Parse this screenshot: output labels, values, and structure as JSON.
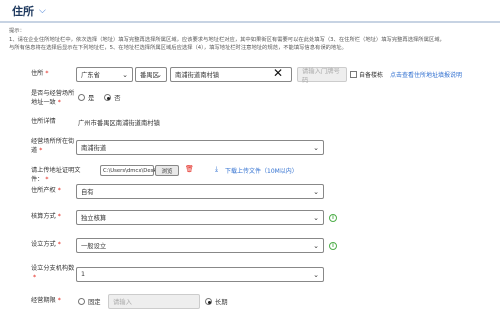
{
  "header": {
    "title": "住所",
    "collapse_icon": "chevron-down-icon"
  },
  "notes": [
    "提示：",
    "1、请在企业住所地址栏中，依次选择（地址）填写完整再选择所属区域，应该要求与地址栏对应，其中如果街区有需要可以在此处填写（3、在住所栏（地址）填写完整再选择所属区域，",
    "与所有信息将在选择后显示在下列地址栏，5、在地址栏选择所属区域后应选择（4），填写地址栏时注意地址的规范，不能填写信息有误的地址。"
  ],
  "address": {
    "label": "住所",
    "province": "广东省",
    "district": "番禺区",
    "street": "南浦街道南村镇",
    "house_placeholder": "请输入门牌号码",
    "checkbox_label": "自备楼栋",
    "link": "点击查看住所地址填报说明"
  },
  "same_as_business": {
    "label": "是否与经营场所地址一致",
    "yes": "是",
    "no": "否"
  },
  "address_detail": {
    "label": "住所详情",
    "value": "广州市番禺区南浦街道南村镇"
  },
  "business_location": {
    "label": "经营场所所在街道",
    "value": "南浦街道"
  },
  "upload": {
    "label": "请上传地址证明文件：",
    "file_path": "C:\\Users\\dmcx\\Desktop\\",
    "browse": "浏览",
    "download_link": "下载上传文件（10M以内）"
  },
  "property": {
    "label": "住所产权",
    "value": "自有"
  },
  "accounting": {
    "label": "核算方式",
    "value": "独立核算"
  },
  "establishment": {
    "label": "设立方式",
    "value": "一般设立"
  },
  "branches": {
    "label": "设立分支机构数",
    "value": "1"
  },
  "term": {
    "label": "经营期限",
    "fixed": "固定",
    "input_placeholder": "请输入",
    "long_term": "长期"
  },
  "colors": {
    "accent": "#2f6fd0",
    "required": "#e2231a",
    "info": "#4fae4a"
  }
}
